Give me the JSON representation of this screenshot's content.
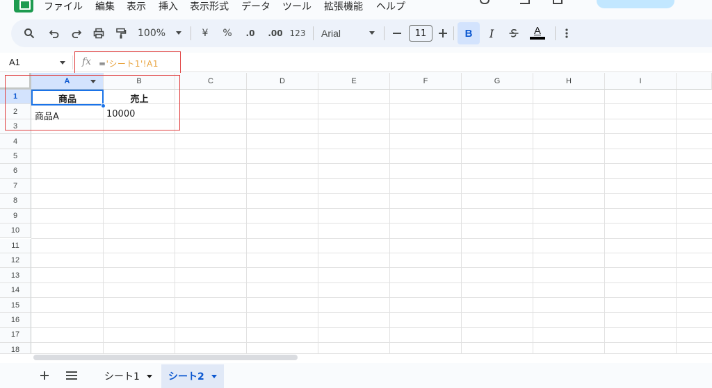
{
  "menu": {
    "items": [
      "ファイル",
      "編集",
      "表示",
      "挿入",
      "表示形式",
      "データ",
      "ツール",
      "拡張機能",
      "ヘルプ"
    ]
  },
  "toolbar": {
    "zoom": "100%",
    "currency": "¥",
    "percent": "%",
    "decimal_decrease": ".0",
    "decimal_increase": ".00",
    "number_format": "123",
    "font_name": "Arial",
    "font_size": "11",
    "bold": "B",
    "italic": "I",
    "text_color": "A"
  },
  "formula_bar": {
    "name_box": "A1",
    "fx": "fx",
    "formula_prefix": "=",
    "formula_ref": "'シート1'!A1"
  },
  "grid": {
    "columns": [
      "A",
      "B",
      "C",
      "D",
      "E",
      "F",
      "G",
      "H",
      "I"
    ],
    "rows": [
      "1",
      "2",
      "3",
      "4",
      "5",
      "6",
      "7",
      "8",
      "9",
      "10",
      "11",
      "12",
      "13",
      "14",
      "15",
      "16",
      "17",
      "18"
    ],
    "cells": {
      "A1": "商品",
      "B1": "売上",
      "A2": "商品A",
      "B2": "10000"
    },
    "selected_cell": "A1"
  },
  "sheets": {
    "tabs": [
      {
        "label": "シート1",
        "active": false
      },
      {
        "label": "シート2",
        "active": true
      }
    ]
  },
  "colors": {
    "accent": "#0b57d0",
    "selection": "#1a73e8",
    "annotation": "#e04040",
    "formula_ref": "#e8a33d",
    "brand": "#1e9b50"
  }
}
